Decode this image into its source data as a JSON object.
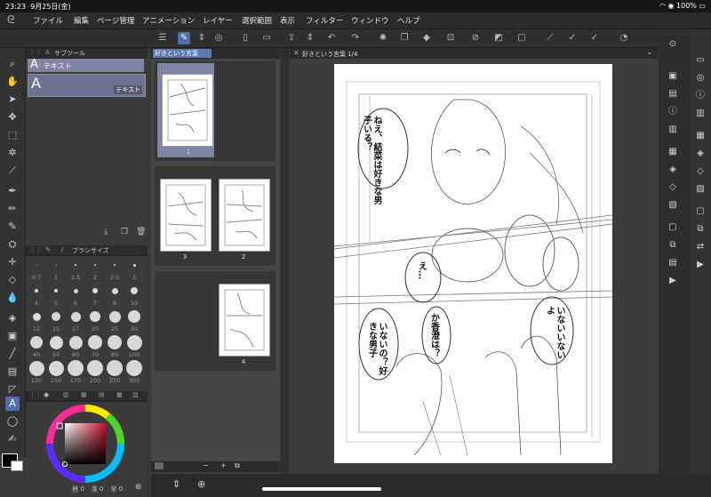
{
  "status_bar": {
    "time": "23:23",
    "date": "9月25日(金)",
    "battery": "100%"
  },
  "menu": {
    "items": [
      "ファイル",
      "編集",
      "ページ管理",
      "アニメーション",
      "レイヤー",
      "選択範囲",
      "表示",
      "フィルター",
      "ウィンドウ",
      "ヘルプ"
    ]
  },
  "subtool": {
    "title": "サブツール",
    "tool_name": "テキスト",
    "item_label": "テキスト"
  },
  "brush": {
    "title": "ブラシサイズ",
    "sizes": [
      "0.7",
      "1",
      "1.5",
      "2",
      "2.5",
      "3",
      "4",
      "5",
      "6",
      "7",
      "8",
      "10",
      "12",
      "15",
      "17",
      "20",
      "25",
      "30",
      "40",
      "50",
      "60",
      "70",
      "80",
      "100",
      "120",
      "150",
      "170",
      "200",
      "250",
      "300"
    ]
  },
  "color": {
    "h": "0",
    "s": "0",
    "v": "0",
    "h_label": "H",
    "s_label": "S",
    "v_label": "V"
  },
  "page_manager": {
    "tab": "好きという言葉",
    "pages": [
      "1",
      "3",
      "2",
      "4"
    ]
  },
  "canvas": {
    "tab": "好きという言葉 1/4"
  },
  "manga": {
    "b1": "ねえ、結菜は好きな男子いる？",
    "b2": "え…",
    "b3": "いないの？好きな男子",
    "b4": "か香澄は？",
    "b5": "いないいないよ"
  }
}
